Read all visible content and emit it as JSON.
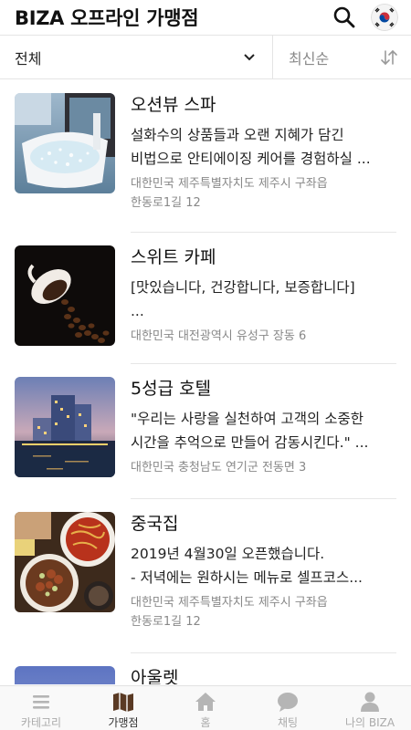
{
  "header": {
    "title": "BIZA 오프라인 가맹점",
    "search_icon": "search-icon",
    "flag_icon": "korea-flag-icon"
  },
  "filters": {
    "category_value": "전체",
    "sort_value": "최신순"
  },
  "stores": [
    {
      "name": "오션뷰 스파",
      "desc_lines": [
        "설화수의 상품들과 오랜 지혜가 담긴",
        "비법으로 안티에이징 케어를 경험하실 ..."
      ],
      "addr_lines": [
        "대한민국 제주특별자치도 제주시 구좌읍",
        "한동로1길 12"
      ]
    },
    {
      "name": "스위트 카페",
      "desc_lines": [
        "[맛있습니다, 건강합니다, 보증합니다]",
        "..."
      ],
      "addr_lines": [
        "대한민국 대전광역시 유성구 장동 6"
      ]
    },
    {
      "name": "5성급 호텔",
      "desc_lines": [
        "\"우리는 사랑을 실천하여 고객의 소중한",
        "시간을 추억으로 만들어 감동시킨다.\" ..."
      ],
      "addr_lines": [
        "대한민국 충청남도 연기군 전동면 3"
      ]
    },
    {
      "name": "중국집",
      "desc_lines": [
        "2019년 4월30일 오픈했습니다.",
        "- 저녁에는 원하시는 메뉴로 셀프코스..."
      ],
      "addr_lines": [
        "대한민국 제주특별자치도 제주시 구좌읍",
        "한동로1길 12"
      ]
    },
    {
      "name": "아울렛",
      "desc_lines": [],
      "addr_lines": []
    }
  ],
  "tabs": [
    {
      "label": "카테고리",
      "icon": "menu-icon"
    },
    {
      "label": "가맹점",
      "icon": "map-icon"
    },
    {
      "label": "홈",
      "icon": "home-icon"
    },
    {
      "label": "채팅",
      "icon": "chat-icon"
    },
    {
      "label": "나의 BIZA",
      "icon": "person-icon"
    }
  ],
  "active_tab": "가맹점"
}
